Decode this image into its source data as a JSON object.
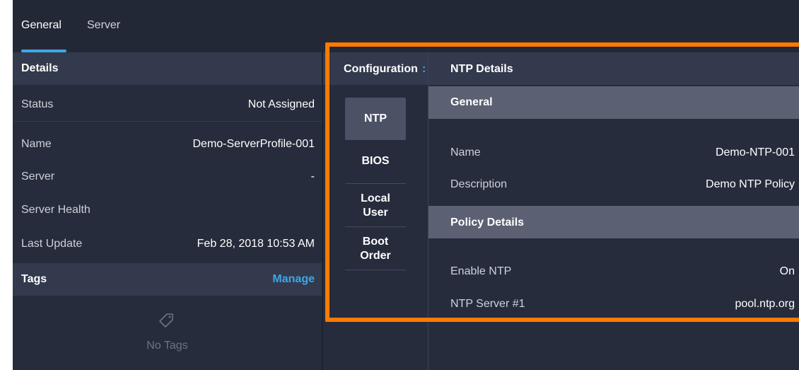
{
  "tabs": [
    {
      "label": "General",
      "active": true
    },
    {
      "label": "Server",
      "active": false
    }
  ],
  "details": {
    "header": "Details",
    "rows": [
      {
        "key": "Status",
        "value": "Not Assigned"
      },
      {
        "key": "Name",
        "value": "Demo-ServerProfile-001"
      },
      {
        "key": "Server",
        "value": "-"
      },
      {
        "key": "Server Health",
        "value": ""
      },
      {
        "key": "Last Update",
        "value": "Feb 28, 2018 10:53 AM"
      }
    ]
  },
  "tags": {
    "header": "Tags",
    "manage_label": "Manage",
    "empty_label": "No Tags",
    "empty_icon": "tag-icon"
  },
  "configuration": {
    "title": "Configuration",
    "title_overflow": ":",
    "items": [
      "NTP",
      "BIOS",
      "Local User",
      "Boot Order"
    ],
    "active_item": "NTP"
  },
  "ntp_details": {
    "title": "NTP Details",
    "general_header": "General",
    "general_rows": [
      {
        "key": "Name",
        "value": "Demo-NTP-001"
      },
      {
        "key": "Description",
        "value": "Demo NTP Policy"
      }
    ],
    "policy_header": "Policy Details",
    "policy_rows": [
      {
        "key": "Enable NTP",
        "value": "On"
      },
      {
        "key": "NTP Server #1",
        "value": "pool.ntp.org"
      }
    ]
  },
  "colors": {
    "accent": "#3ea6e8",
    "highlight": "#ff7a00",
    "background": "#232837"
  }
}
